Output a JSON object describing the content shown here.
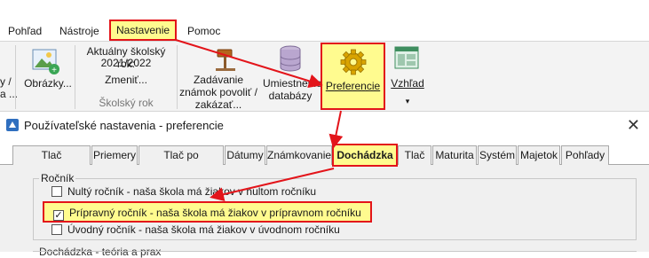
{
  "menu": {
    "items": [
      "Pohľad",
      "Nástroje",
      "Nastavenie",
      "Pomoc"
    ]
  },
  "ribbon": {
    "partial_left": "y /\na ...",
    "images_label": "Obrázky...",
    "school_year_label": "Aktuálny školský rok:",
    "school_year_value": "2021/2022",
    "change_label": "Zmeniť...",
    "school_year_group": "Školský rok",
    "grades_label": "Zadávanie známok povoliť / zakázať...",
    "db_label": "Umiestnenie databázy",
    "pref_label": "Preferencie",
    "view_label": "Vzhľad",
    "view_arrow": "▾"
  },
  "dialog": {
    "title": "Používateľské nastavenia - preferencie",
    "close": "✕",
    "tabs": [
      "Tlač vysvedčení",
      "Priemery",
      "Tlač po polrokoch",
      "Dátumy",
      "Známkovanie",
      "Dochádzka",
      "Tlač",
      "Maturita",
      "Systém",
      "Majetok",
      "Pohľady"
    ],
    "active_tab": "Dochádzka",
    "group_title": "Ročník",
    "options": [
      {
        "label": "Nultý ročník - naša škola má žiakov v nultom ročníku",
        "checked": false
      },
      {
        "label": "Prípravný ročník - naša škola má žiakov v prípravnom ročníku",
        "checked": true
      },
      {
        "label": "Úvodný ročník - naša škola má žiakov v úvodnom ročníku",
        "checked": false
      }
    ],
    "next_group_title": "Dochádzka - teória a prax"
  },
  "colors": {
    "highlight": "#fffb8f",
    "annotation_red": "#e3141a"
  },
  "icons": [
    "image-add-icon",
    "hammer-icon",
    "database-icon",
    "gear-icon",
    "layout-icon",
    "app-icon"
  ]
}
